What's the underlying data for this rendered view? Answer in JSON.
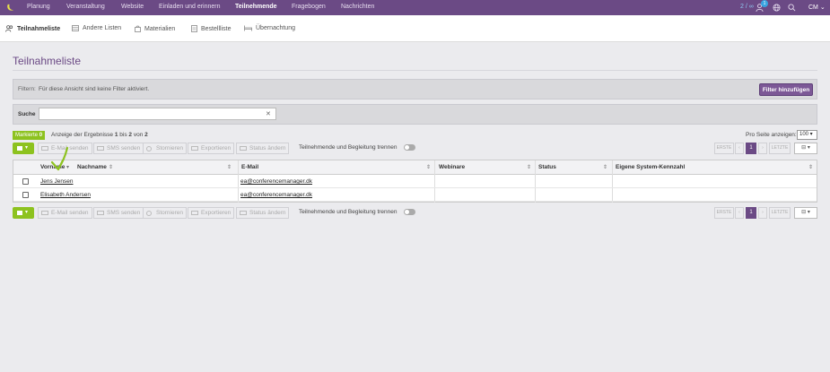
{
  "topnav": {
    "items": [
      "Planung",
      "Veranstaltung",
      "Website",
      "Einladen und erinnern",
      "Teilnehmende",
      "Fragebogen",
      "Nachrichten"
    ],
    "active": "Teilnehmende",
    "counter": "2 / ∞",
    "badge": "1",
    "user": "CM",
    "brand_color": "#6b4a85"
  },
  "subnav": {
    "items": [
      "Teilnahmeliste",
      "Andere Listen",
      "Materialien",
      "Bestellliste",
      "Übernachtung"
    ]
  },
  "page": {
    "title": "Teilnahmeliste"
  },
  "filter": {
    "label": "Filtern:",
    "text": "Für diese Ansicht sind keine Filter aktiviert.",
    "button": "Filter hinzufügen"
  },
  "search": {
    "label": "Suche",
    "value": "",
    "clear": "✕"
  },
  "results": {
    "marked_label": "Markierte",
    "marked_count": "0",
    "prefix": "Anzeige der Ergebnisse",
    "from": "1",
    "mid": "bis",
    "to": "2",
    "of": "von",
    "total": "2",
    "per_page_label": "Pro Seite anzeigen:",
    "per_page": "100 ▾"
  },
  "toolbar": {
    "email": "E-Mail senden",
    "sms": "SMS senden",
    "cancel": "Stornieren",
    "export": "Exportieren",
    "status": "Status ändern",
    "split": "Teilnehmende und Begleitung trennen",
    "first": "ERSTE",
    "prev": "‹",
    "page": "1",
    "next": "›",
    "last": "LETZTE"
  },
  "table": {
    "headers": [
      "Vorname",
      "Nachname",
      "E-Mail",
      "Webinare",
      "Status",
      "Eigene System-Kennzahl"
    ],
    "rows": [
      [
        "Jens Jensen",
        "ea@conferencemanager.dk"
      ],
      [
        "Elisabeth Andersen",
        "ea@conferencemanager.dk"
      ]
    ]
  }
}
